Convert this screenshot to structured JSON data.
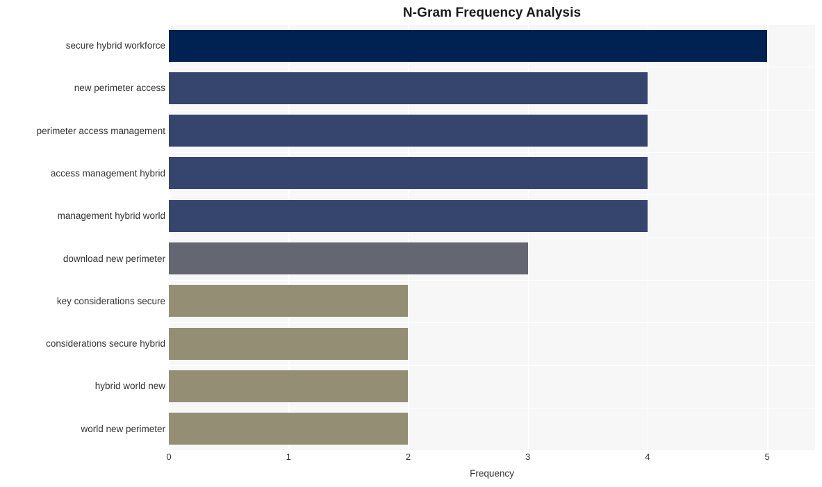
{
  "chart_data": {
    "type": "bar",
    "orientation": "horizontal",
    "title": "N-Gram Frequency Analysis",
    "xlabel": "Frequency",
    "ylabel": "",
    "xlim": [
      0,
      5.4
    ],
    "xticks": [
      "0",
      "1",
      "2",
      "3",
      "4",
      "5"
    ],
    "xtick_values": [
      0,
      1,
      2,
      3,
      4,
      5
    ],
    "grid": "vertical-and-horizontal-white-on-light-background",
    "legend": "none",
    "categories": [
      "secure hybrid workforce",
      "new perimeter access",
      "perimeter access management",
      "access management hybrid",
      "management hybrid world",
      "download new perimeter",
      "key considerations secure",
      "considerations secure hybrid",
      "hybrid world new",
      "world new perimeter"
    ],
    "values": [
      5,
      4,
      4,
      4,
      4,
      3,
      2,
      2,
      2,
      2
    ],
    "bar_colors": [
      "#002253",
      "#36456e",
      "#36456e",
      "#36456e",
      "#36456e",
      "#646772",
      "#948e75",
      "#948e75",
      "#948e75",
      "#948e75"
    ],
    "plot_background": "#f7f7f7",
    "figure_background": "#ffffff",
    "text_color": "#333333",
    "title_color": "#1a1a1a"
  }
}
